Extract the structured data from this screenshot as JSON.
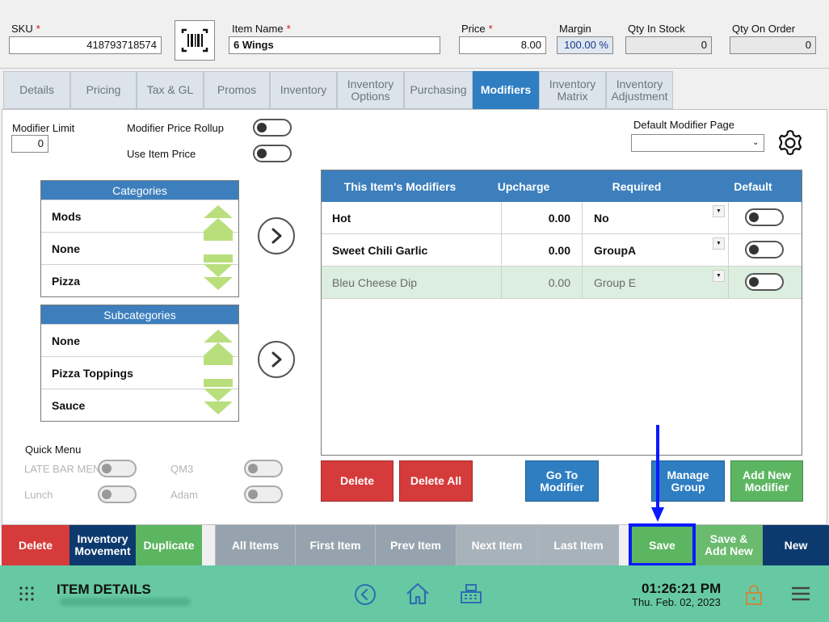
{
  "header": {
    "sku_label": "SKU",
    "sku_value": "418793718574",
    "item_name_label": "Item Name",
    "item_name_value": "6 Wings",
    "price_label": "Price",
    "price_value": "8.00",
    "margin_label": "Margin",
    "margin_value": "100.00 %",
    "qty_stock_label": "Qty In Stock",
    "qty_stock_value": "0",
    "qty_order_label": "Qty On Order",
    "qty_order_value": "0",
    "required_mark": "*"
  },
  "tabs": [
    {
      "label": "Details"
    },
    {
      "label": "Pricing"
    },
    {
      "label": "Tax & GL"
    },
    {
      "label": "Promos"
    },
    {
      "label": "Inventory"
    },
    {
      "label": "Inventory Options"
    },
    {
      "label": "Purchasing"
    },
    {
      "label": "Modifiers"
    },
    {
      "label": "Inventory Matrix"
    },
    {
      "label": "Inventory Adjustment"
    }
  ],
  "modifiers": {
    "limit_label": "Modifier Limit",
    "limit_value": "0",
    "price_rollup_label": "Modifier Price Rollup",
    "use_item_price_label": "Use Item Price",
    "default_page_label": "Default Modifier Page",
    "default_page_value": ""
  },
  "categories": {
    "title": "Categories",
    "items": [
      "Mods",
      "None",
      "Pizza"
    ]
  },
  "subcategories": {
    "title": "Subcategories",
    "items": [
      "None",
      "Pizza Toppings",
      "Sauce"
    ]
  },
  "grid": {
    "headers": [
      "This Item's Modifiers",
      "Upcharge",
      "Required",
      "Default"
    ],
    "rows": [
      {
        "name": "Hot",
        "upcharge": "0.00",
        "required": "No"
      },
      {
        "name": "Sweet Chili Garlic",
        "upcharge": "0.00",
        "required": "GroupA"
      },
      {
        "name": "Bleu Cheese Dip",
        "upcharge": "0.00",
        "required": "Group E"
      }
    ]
  },
  "actions": {
    "delete": "Delete",
    "delete_all": "Delete All",
    "go_to_modifier": "Go To Modifier",
    "manage_group": "Manage Group",
    "add_new_modifier": "Add New Modifier"
  },
  "quick_menu": {
    "title": "Quick Menu",
    "items": [
      "LATE BAR MENU",
      "QM3",
      "Lunch",
      "Adam"
    ]
  },
  "bottom_bar": {
    "delete": "Delete",
    "inventory_movement": "Inventory Movement",
    "duplicate": "Duplicate",
    "all_items": "All Items",
    "first_item": "First Item",
    "prev_item": "Prev Item",
    "next_item": "Next Item",
    "last_item": "Last Item",
    "save": "Save",
    "save_add_new": "Save & Add New",
    "new": "New"
  },
  "footer": {
    "title": "ITEM DETAILS",
    "time": "01:26:21 PM",
    "date": "Thu. Feb. 02, 2023"
  },
  "colors": {
    "accent_blue": "#2f7ec2",
    "header_blue": "#3d7fbd",
    "danger_red": "#d63b3b",
    "success_green": "#5cb661",
    "footer_teal": "#66c9a4",
    "annotation_blue": "#0a1aff"
  }
}
